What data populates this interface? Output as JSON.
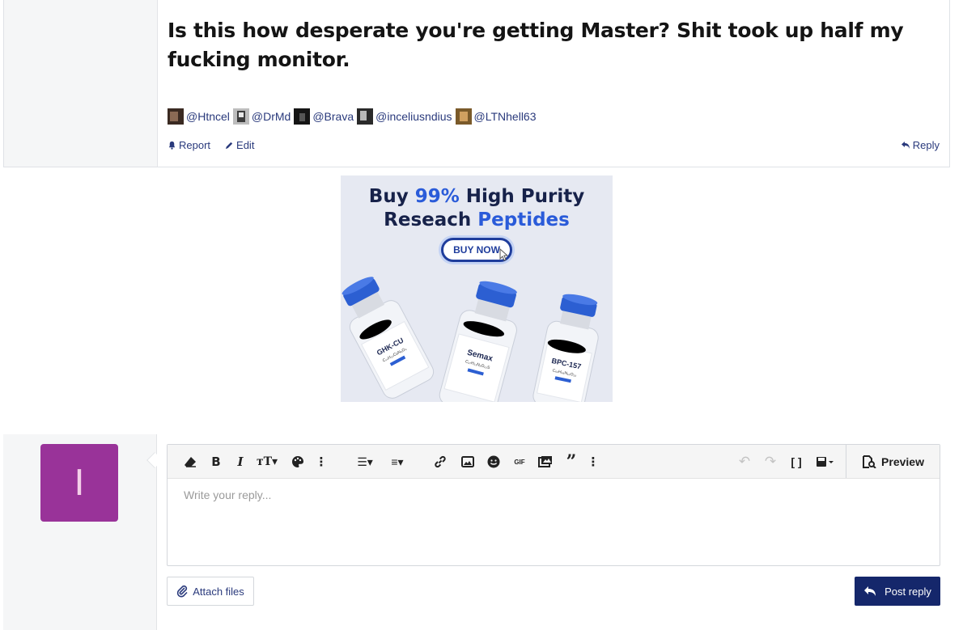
{
  "post": {
    "title": "Is this how desperate you're getting Master? Shit took up half my fucking monitor.",
    "mentions": [
      {
        "name": "@Htncel"
      },
      {
        "name": "@DrMd"
      },
      {
        "name": "@Brava"
      },
      {
        "name": "@inceliusndius"
      },
      {
        "name": "@LTNhell63"
      }
    ],
    "actions": {
      "report": "Report",
      "edit": "Edit",
      "reply": "Reply"
    }
  },
  "ad": {
    "line1_pre": "Buy ",
    "line1_highlight": "99%",
    "line1_post": " High Purity",
    "line2_pre": "Reseach ",
    "line2_highlight": "Peptides",
    "button": "BUY NOW",
    "vials": [
      {
        "name": "GHK-CU",
        "formula": "C₁₄H₂₄CuN₆O₄"
      },
      {
        "name": "Semax",
        "formula": "C₃₇H₅₁N₉O₁₀S"
      },
      {
        "name": "BPC-157",
        "formula": "C₆₂H₉₈N₁₆O₂₂"
      }
    ]
  },
  "reply": {
    "avatar_letter": "I",
    "avatar_color": "#993399",
    "placeholder": "Write your reply...",
    "preview": "Preview",
    "attach": "Attach files",
    "post_reply": "Post reply",
    "toolbar_gif": "GIF"
  },
  "colors": {
    "link": "#2a3a7c",
    "accent": "#15276b",
    "ad_blue": "#2a5bd9"
  }
}
